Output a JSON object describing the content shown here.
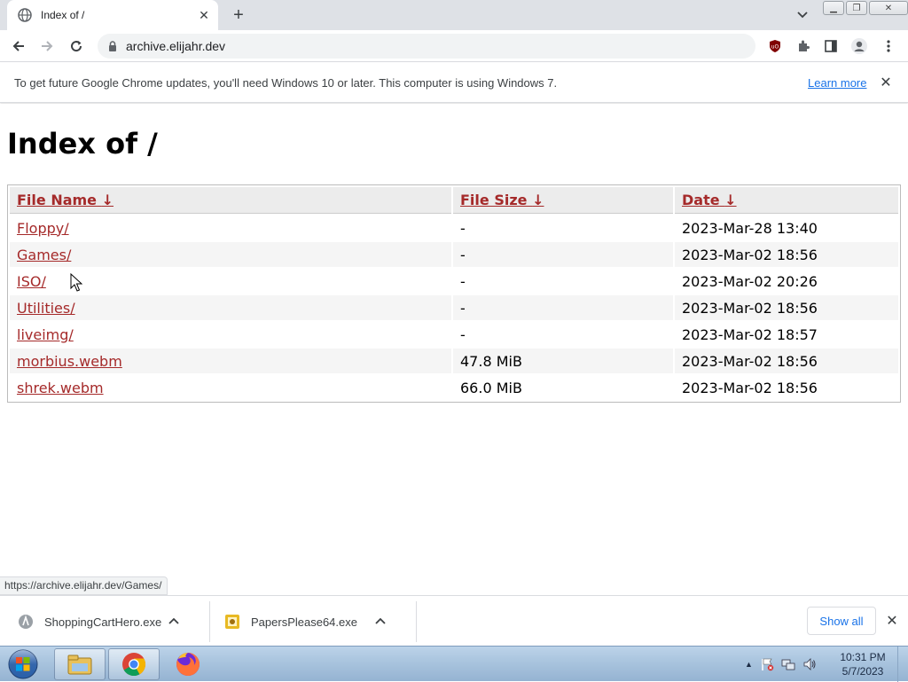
{
  "browser": {
    "tab_title": "Index of /",
    "url": "archive.elijahr.dev",
    "infobar_message": "To get future Google Chrome updates, you'll need Windows 10 or later. This computer is using Windows 7.",
    "infobar_link": "Learn more",
    "status_url": "https://archive.elijahr.dev/Games/"
  },
  "page": {
    "heading": "Index of /",
    "columns": [
      {
        "label": "File Name",
        "sort": "↓"
      },
      {
        "label": "File Size",
        "sort": "↓"
      },
      {
        "label": "Date",
        "sort": "↓"
      }
    ],
    "rows": [
      {
        "name": "Floppy/",
        "size": "-",
        "date": "2023-Mar-28 13:40"
      },
      {
        "name": "Games/",
        "size": "-",
        "date": "2023-Mar-02 18:56"
      },
      {
        "name": "ISO/",
        "size": "-",
        "date": "2023-Mar-02 20:26"
      },
      {
        "name": "Utilities/",
        "size": "-",
        "date": "2023-Mar-02 18:56"
      },
      {
        "name": "liveimg/",
        "size": "-",
        "date": "2023-Mar-02 18:57"
      },
      {
        "name": "morbius.webm",
        "size": "47.8 MiB",
        "date": "2023-Mar-02 18:56"
      },
      {
        "name": "shrek.webm",
        "size": "66.0 MiB",
        "date": "2023-Mar-02 18:56"
      }
    ]
  },
  "downloads": {
    "items": [
      {
        "name": "ShoppingCartHero.exe",
        "icon": "app-icon"
      },
      {
        "name": "PapersPlease64.exe",
        "icon": "exe-icon"
      }
    ],
    "show_all": "Show all"
  },
  "taskbar": {
    "time": "10:31 PM",
    "date": "5/7/2023",
    "apps": [
      "explorer-icon",
      "chrome-icon",
      "firefox-icon"
    ]
  },
  "colors": {
    "link": "#a52a2a",
    "accent": "#1a73e8"
  }
}
